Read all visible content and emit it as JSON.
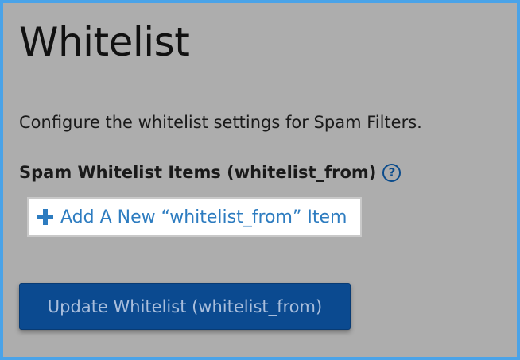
{
  "page": {
    "title": "Whitelist",
    "description": "Configure the whitelist settings for Spam Filters."
  },
  "whitelist_section": {
    "label": "Spam Whitelist Items (whitelist_from)",
    "help_icon": "question-circle-icon",
    "add_item_label": "Add A New “whitelist_from” Item",
    "add_icon": "plus-icon"
  },
  "actions": {
    "update_label": "Update Whitelist (whitelist_from)"
  },
  "colors": {
    "background": "#adadad",
    "frame_border": "#4aa3e8",
    "link_blue": "#2d7cc0",
    "button_blue": "#0b4a90",
    "help_icon_blue": "#0b4c8c"
  }
}
